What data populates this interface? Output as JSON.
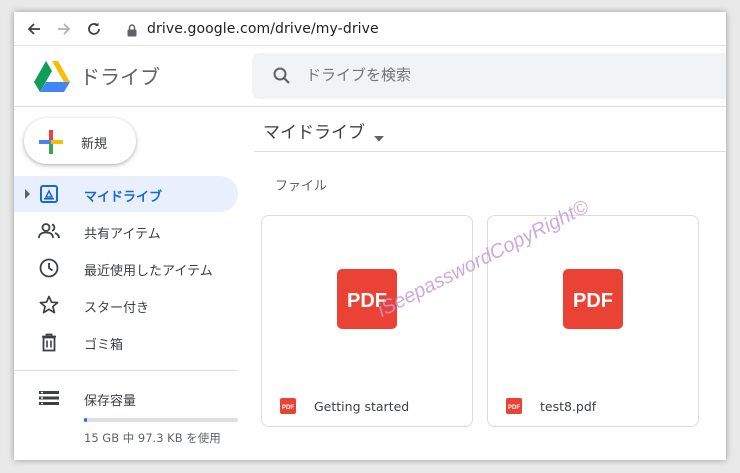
{
  "browser": {
    "url": "drive.google.com/drive/my-drive",
    "icons": [
      "back-arrow-icon",
      "forward-arrow-icon",
      "reload-icon",
      "lock-icon"
    ]
  },
  "app": {
    "title": "ドライブ",
    "logo": "google-drive-logo"
  },
  "search": {
    "placeholder": "ドライブを検索"
  },
  "sidebar": {
    "new_label": "新規",
    "items": [
      {
        "label": "マイドライブ",
        "icon": "my-drive-icon",
        "active": true
      },
      {
        "label": "共有アイテム",
        "icon": "people-icon",
        "active": false
      },
      {
        "label": "最近使用したアイテム",
        "icon": "clock-icon",
        "active": false
      },
      {
        "label": "スター付き",
        "icon": "star-icon",
        "active": false
      },
      {
        "label": "ゴミ箱",
        "icon": "trash-icon",
        "active": false
      }
    ],
    "storage": {
      "label": "保存容量",
      "icon": "storage-icon",
      "usage_text": "15 GB 中 97.3 KB を使用",
      "used_fraction": 0.01
    }
  },
  "main": {
    "title": "マイドライブ",
    "section_label": "ファイル",
    "files": [
      {
        "name": "Getting started",
        "type": "PDF"
      },
      {
        "name": "test8.pdf",
        "type": "PDF"
      }
    ]
  },
  "watermark": "iSeepasswordCopyRight©",
  "colors": {
    "accent_blue": "#1a73e8",
    "active_bg": "#e8f0fe",
    "active_text": "#1967d2",
    "pdf_red": "#ea4335",
    "watermark": "#c59bd9"
  }
}
